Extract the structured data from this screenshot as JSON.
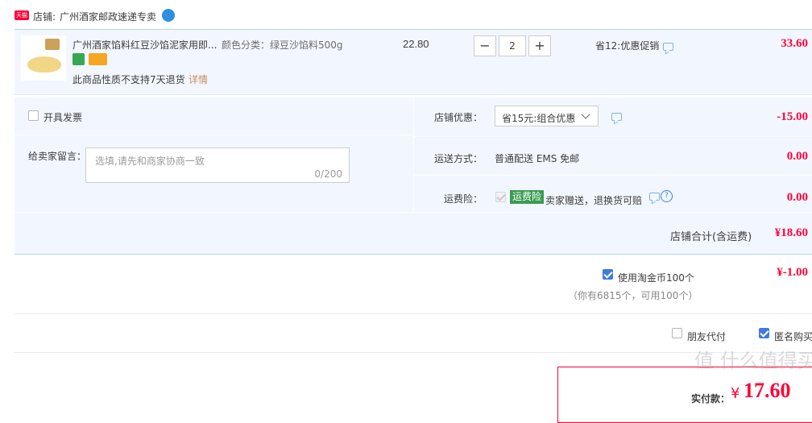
{
  "shop": {
    "badge": "天猫",
    "label": "店铺:",
    "name": "广州酒家邮政速递专卖"
  },
  "item": {
    "title": "广州酒家馅料红豆沙馅泥家用即...",
    "sku_label": "颜色分类：",
    "sku_value": "绿豆沙馅料500g",
    "unit_price": "22.80",
    "quantity": "2",
    "promo": "省12:优惠促销",
    "subtotal": "33.60",
    "return_note": "此商品性质不支持7天退货",
    "return_link": "详情"
  },
  "invoice": {
    "label": "开具发票"
  },
  "message": {
    "label": "给卖家留言：",
    "placeholder": "选填,请先和商家协商一致",
    "counter": "0/200"
  },
  "shop_discount": {
    "label": "店铺优惠：",
    "selected": "省15元:组合优惠",
    "amount": "-15.00"
  },
  "shipping": {
    "label": "运送方式：",
    "method": "普通配送 EMS 免邮",
    "amount": "0.00"
  },
  "freight_insurance": {
    "label": "运费险：",
    "tag": "运费险",
    "text": "卖家赠送，退换货可赔",
    "amount": "0.00"
  },
  "shop_total": {
    "label": "店铺合计(含运费)",
    "amount": "¥18.60"
  },
  "coins": {
    "label": "使用淘金币100个",
    "note": "（你有6815个，可用100个）",
    "amount": "¥-1.00"
  },
  "options": {
    "friend_pay": "朋友代付",
    "anonymous": "匿名购买"
  },
  "final": {
    "label": "实付款：",
    "currency": "¥",
    "amount": "17.60"
  },
  "watermark": "值 什么值得买",
  "colors": {
    "accent": "#ff0036",
    "panel": "#f2f7ff",
    "checkbox": "#3f7ae0",
    "tag_green": "#3a9c52"
  }
}
